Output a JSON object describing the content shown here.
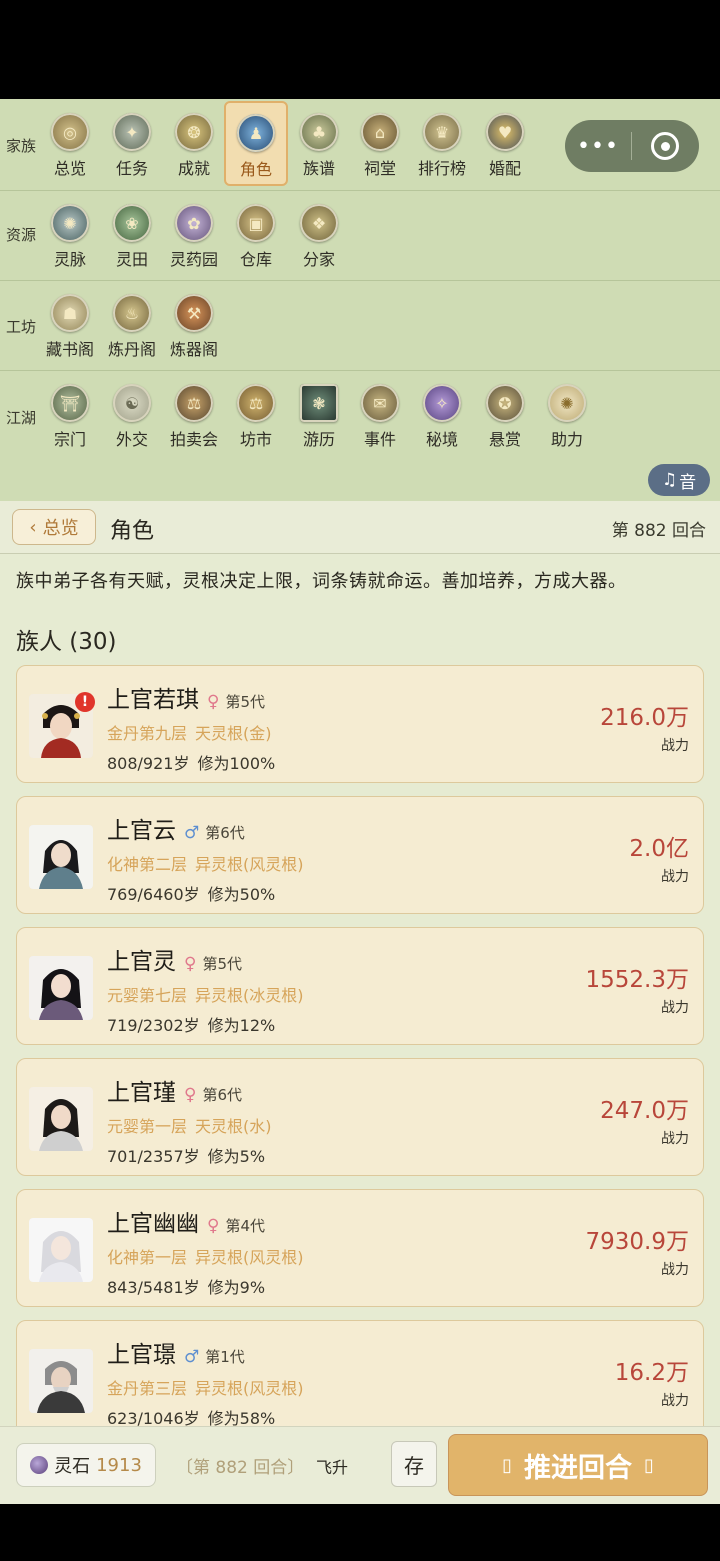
{
  "menu": {
    "rows": [
      {
        "label": "家族",
        "items": [
          {
            "label": "总览",
            "icon": "overview-icon",
            "active": false
          },
          {
            "label": "任务",
            "icon": "task-icon",
            "active": false
          },
          {
            "label": "成就",
            "icon": "achievement-icon",
            "active": false
          },
          {
            "label": "角色",
            "icon": "character-icon",
            "active": true
          },
          {
            "label": "族谱",
            "icon": "family-tree-icon",
            "active": false
          },
          {
            "label": "祠堂",
            "icon": "ancestral-hall-icon",
            "active": false
          },
          {
            "label": "排行榜",
            "icon": "leaderboard-icon",
            "active": false
          },
          {
            "label": "婚配",
            "icon": "marriage-icon",
            "active": false
          }
        ]
      },
      {
        "label": "资源",
        "items": [
          {
            "label": "灵脉",
            "icon": "spirit-vein-icon"
          },
          {
            "label": "灵田",
            "icon": "spirit-field-icon"
          },
          {
            "label": "灵药园",
            "icon": "herb-garden-icon"
          },
          {
            "label": "仓库",
            "icon": "warehouse-icon"
          },
          {
            "label": "分家",
            "icon": "branch-family-icon"
          }
        ]
      },
      {
        "label": "工坊",
        "items": [
          {
            "label": "藏书阁",
            "icon": "library-icon"
          },
          {
            "label": "炼丹阁",
            "icon": "alchemy-icon"
          },
          {
            "label": "炼器阁",
            "icon": "forge-icon"
          }
        ]
      },
      {
        "label": "江湖",
        "items": [
          {
            "label": "宗门",
            "icon": "sect-icon"
          },
          {
            "label": "外交",
            "icon": "diplomacy-icon"
          },
          {
            "label": "拍卖会",
            "icon": "auction-icon"
          },
          {
            "label": "坊市",
            "icon": "market-icon"
          },
          {
            "label": "游历",
            "icon": "travel-icon"
          },
          {
            "label": "事件",
            "icon": "event-icon"
          },
          {
            "label": "秘境",
            "icon": "secret-realm-icon"
          },
          {
            "label": "悬赏",
            "icon": "bounty-icon"
          },
          {
            "label": "助力",
            "icon": "assist-icon"
          }
        ]
      }
    ],
    "music_label": "音"
  },
  "header": {
    "back_label": "总览",
    "title": "角色",
    "turn": "第 882 回合"
  },
  "intro": "族中弟子各有天赋，灵根决定上限，词条铸就命运。善加培养，方成大器。",
  "section_title": "族人 (30)",
  "members": [
    {
      "name": "上官若琪",
      "gender": "♀",
      "generation": "第5代",
      "realm": "金丹第九层",
      "root": "天灵根(金)",
      "age": "808/921岁",
      "cultivation": "修为100%",
      "power": "216.0万",
      "power_label": "战力",
      "alert": "!"
    },
    {
      "name": "上官云",
      "gender": "♂",
      "generation": "第6代",
      "realm": "化神第二层",
      "root": "异灵根(风灵根)",
      "age": "769/6460岁",
      "cultivation": "修为50%",
      "power": "2.0亿",
      "power_label": "战力"
    },
    {
      "name": "上官灵",
      "gender": "♀",
      "generation": "第5代",
      "realm": "元婴第七层",
      "root": "异灵根(冰灵根)",
      "age": "719/2302岁",
      "cultivation": "修为12%",
      "power": "1552.3万",
      "power_label": "战力"
    },
    {
      "name": "上官瑾",
      "gender": "♀",
      "generation": "第6代",
      "realm": "元婴第一层",
      "root": "天灵根(水)",
      "age": "701/2357岁",
      "cultivation": "修为5%",
      "power": "247.0万",
      "power_label": "战力"
    },
    {
      "name": "上官幽幽",
      "gender": "♀",
      "generation": "第4代",
      "realm": "化神第一层",
      "root": "异灵根(风灵根)",
      "age": "843/5481岁",
      "cultivation": "修为9%",
      "power": "7930.9万",
      "power_label": "战力"
    },
    {
      "name": "上官璟",
      "gender": "♂",
      "generation": "第1代",
      "realm": "金丹第三层",
      "root": "异灵根(风灵根)",
      "age": "623/1046岁",
      "cultivation": "修为58%",
      "power": "16.2万",
      "power_label": "战力"
    }
  ],
  "bottom": {
    "stone_label": "灵石",
    "stone_value": "1913",
    "turn_info": "〔第 882 回合〕",
    "ascend_label": "飞升",
    "save_label": "存",
    "advance_label": "推进回合"
  },
  "colors": {
    "menu_bg": "#cfdcb4",
    "accent_gold": "#e1b46a",
    "power_red": "#b8463a",
    "realm_gold": "#d6a45a"
  }
}
